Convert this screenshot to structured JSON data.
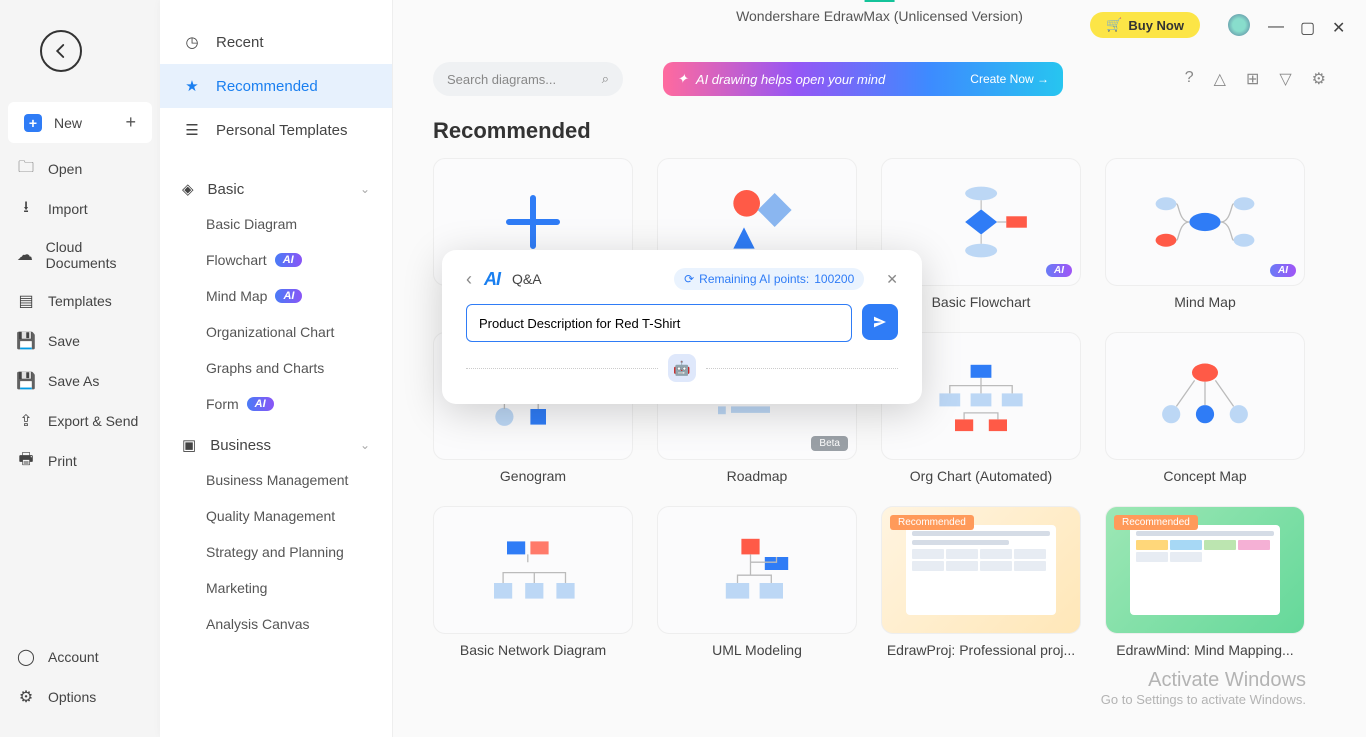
{
  "window": {
    "title": "Wondershare EdrawMax (Unlicensed Version)"
  },
  "buy": {
    "label": "Buy Now"
  },
  "sidebar": {
    "new": "New",
    "items": [
      "Open",
      "Import",
      "Cloud Documents",
      "Templates",
      "Save",
      "Save As",
      "Export & Send",
      "Print"
    ],
    "account": "Account",
    "options": "Options"
  },
  "panel": {
    "top": [
      {
        "label": "Recent"
      },
      {
        "label": "Recommended"
      },
      {
        "label": "Personal Templates"
      }
    ],
    "basic": {
      "label": "Basic",
      "items": [
        "Basic Diagram",
        "Flowchart",
        "Mind Map",
        "Organizational Chart",
        "Graphs and Charts",
        "Form"
      ]
    },
    "business": {
      "label": "Business",
      "items": [
        "Business Management",
        "Quality Management",
        "Strategy and Planning",
        "Marketing",
        "Analysis Canvas"
      ]
    }
  },
  "search": {
    "placeholder": "Search diagrams..."
  },
  "banner": {
    "text": "AI drawing helps open your mind",
    "cta": "Create Now →"
  },
  "section_title": "Recommended",
  "cards": [
    {
      "label": ""
    },
    {
      "label": ""
    },
    {
      "label": "Basic Flowchart"
    },
    {
      "label": "Mind Map"
    },
    {
      "label": "Genogram"
    },
    {
      "label": "Roadmap"
    },
    {
      "label": "Org Chart (Automated)"
    },
    {
      "label": "Concept Map"
    },
    {
      "label": "Basic Network Diagram"
    },
    {
      "label": "UML Modeling"
    },
    {
      "label": "EdrawProj: Professional proj..."
    },
    {
      "label": "EdrawMind: Mind Mapping..."
    }
  ],
  "popup": {
    "title": "Q&A",
    "points_label": "Remaining AI points: ",
    "points_value": "100200",
    "input_value": "Product Description for Red T-Shirt"
  },
  "watermark": {
    "line1": "Activate Windows",
    "line2": "Go to Settings to activate Windows."
  },
  "badges": {
    "ai": "AI",
    "beta": "Beta",
    "recommended": "Recommended"
  }
}
